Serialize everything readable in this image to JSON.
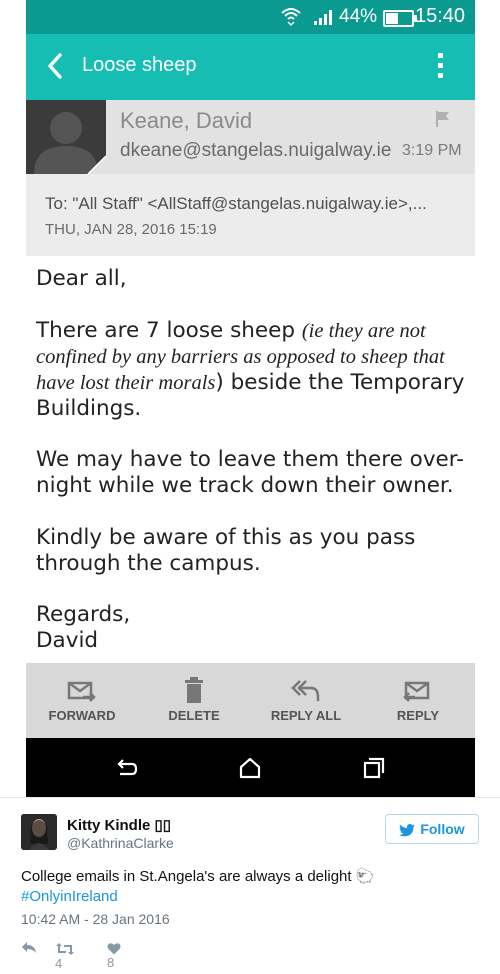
{
  "status_bar": {
    "battery": "44%",
    "battery_level": 0.44,
    "time": "15:40"
  },
  "app_bar": {
    "title": "Loose sheep"
  },
  "sender": {
    "name": "Keane, David",
    "email": "dkeane@stangelas.nuigalway.ie",
    "time": "3:19 PM"
  },
  "recipients": {
    "to": "To: \"All Staff\" <AllStaff@stangelas.nuigalway.ie>,...",
    "date": "THU, JAN 28, 2016 15:19"
  },
  "message": {
    "greeting": "Dear all,",
    "p1_start": "There are 7 loose sheep ",
    "p1_italic": "(ie they are not confined by any barriers as opposed to sheep that have lost their morals",
    "p1_end": ") beside the Temporary Buildings.",
    "p2": "We may have to leave them there over-night while we track down their owner.",
    "p3": "Kindly be aware of this as you pass through the campus.",
    "sign1": "Regards,",
    "sign2": "David"
  },
  "actions": {
    "forward": "FORWARD",
    "delete": "DELETE",
    "reply_all": "REPLY ALL",
    "reply": "REPLY"
  },
  "tweet": {
    "name": "Kitty Kindle",
    "name_suffix": "▯▯",
    "handle": "@KathrinaClarke",
    "follow_label": "Follow",
    "text": "College emails in St.Angela's are always a delight ",
    "emoji": "🐑",
    "hashtag": "#OnlyinIreland",
    "timestamp": "10:42 AM - 28 Jan 2016",
    "retweets": "4",
    "likes": "8"
  },
  "colors": {
    "status_bar": "#0b9a90",
    "app_bar": "#15bdb2",
    "link": "#1b95e0"
  }
}
